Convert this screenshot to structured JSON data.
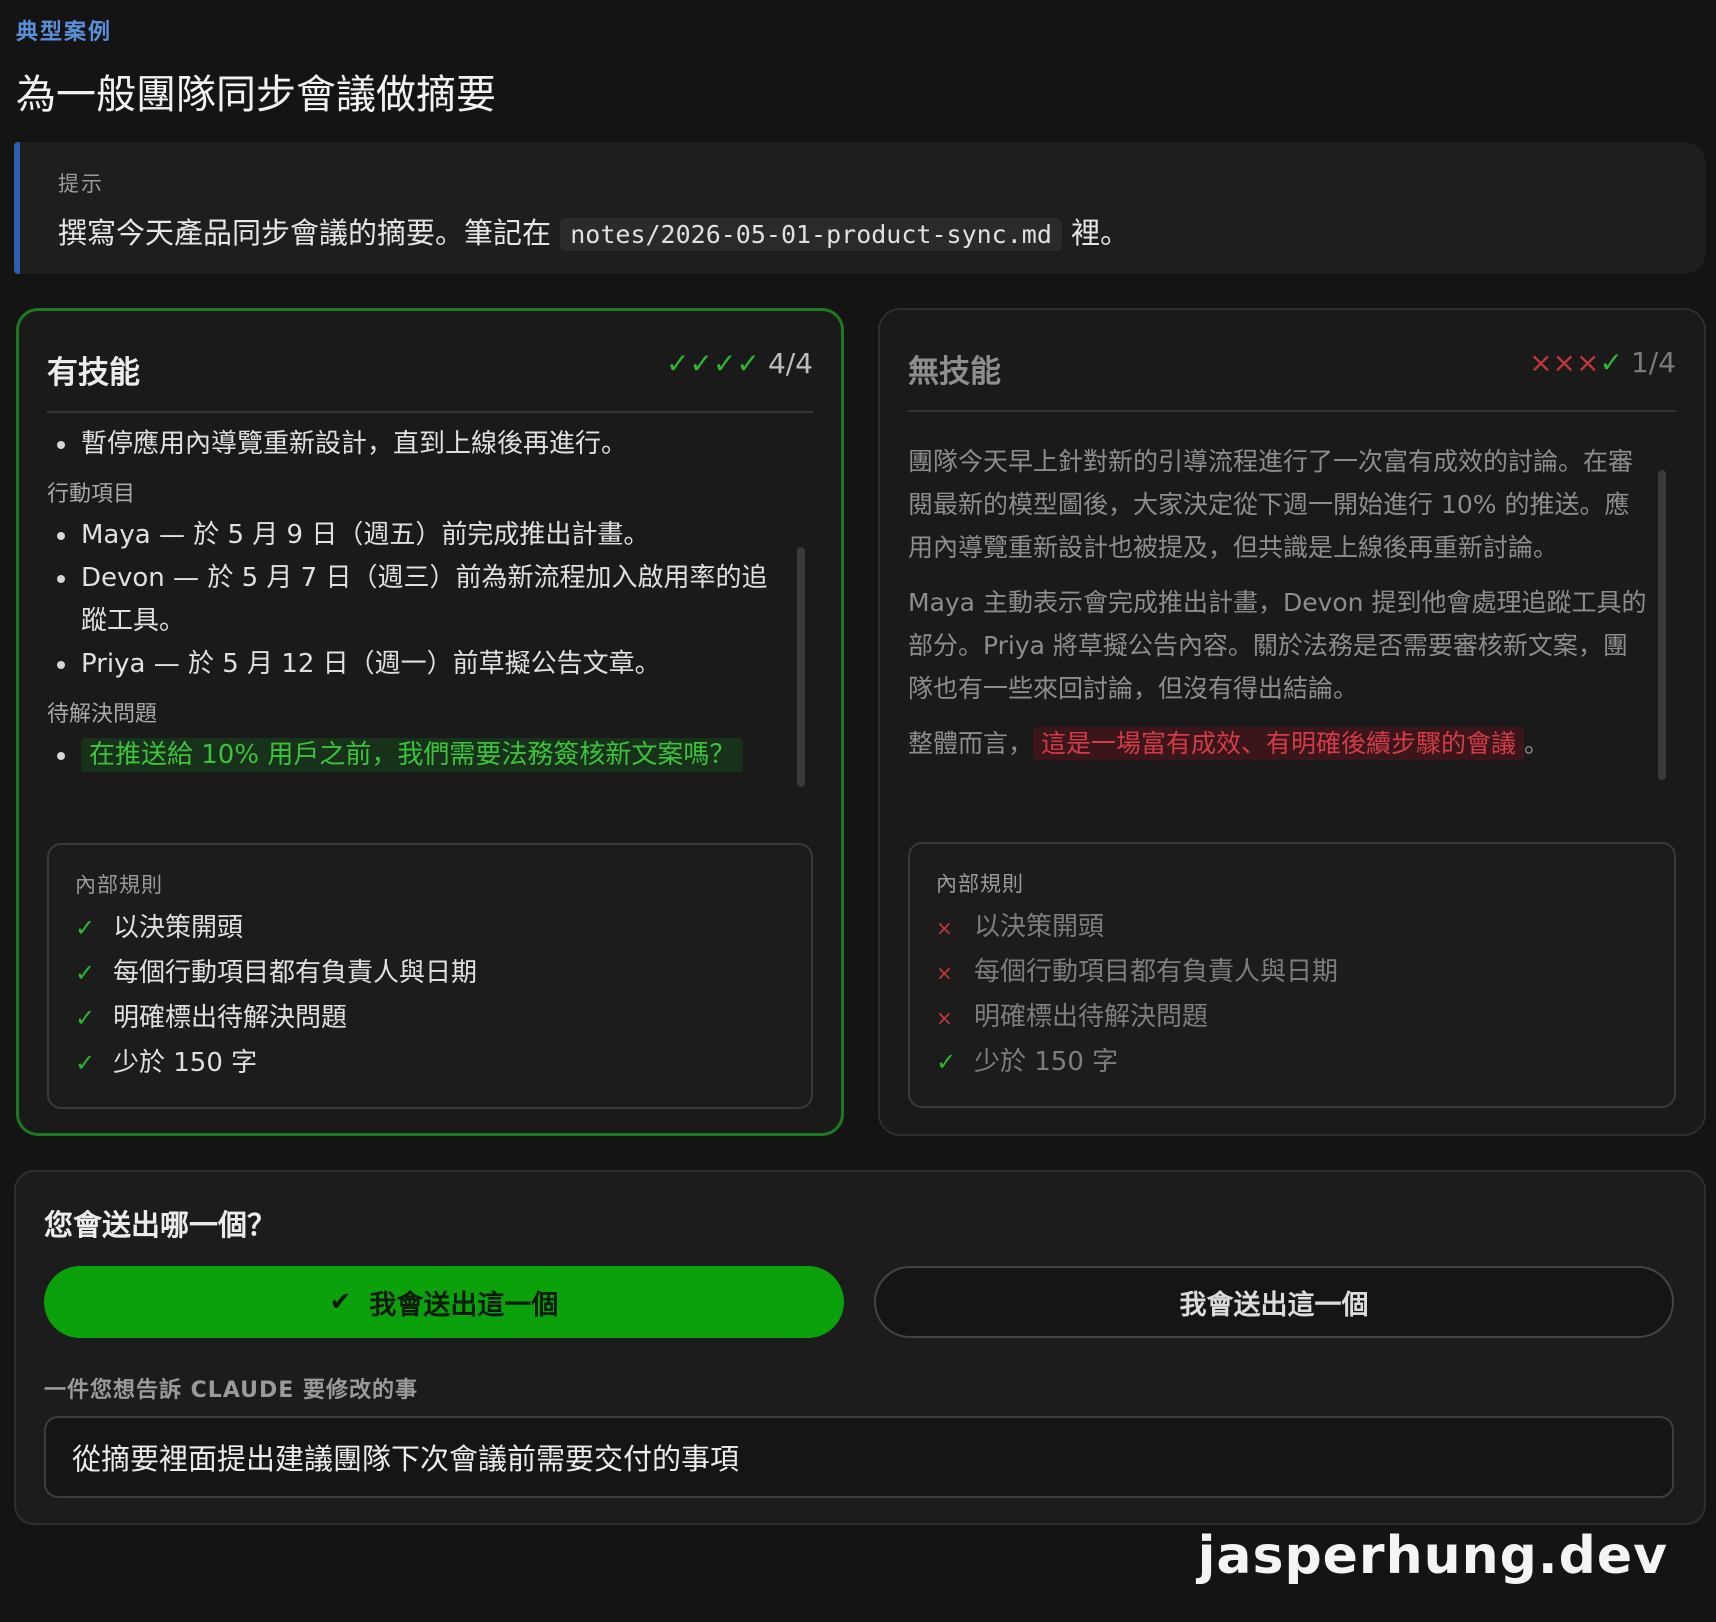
{
  "eyebrow": "典型案例",
  "title": "為一般團隊同步會議做摘要",
  "prompt": {
    "label": "提示",
    "text_before": "撰寫今天產品同步會議的摘要。筆記在 ",
    "code": "notes/2026-05-01-product-sync.md",
    "text_after": " 裡。"
  },
  "with_skill": {
    "title": "有技能",
    "score_marks": "✓✓✓✓",
    "score": "4/4",
    "top_bullet": "暫停應用內導覽重新設計，直到上線後再進行。",
    "action_label": "行動項目",
    "actions": [
      "Maya — 於 5 月 9 日（週五）前完成推出計畫。",
      "Devon — 於 5 月 7 日（週三）前為新流程加入啟用率的追蹤工具。",
      "Priya — 於 5 月 12 日（週一）前草擬公告文章。"
    ],
    "open_label": "待解決問題",
    "open_question": "在推送給 10% 用戶之前，我們需要法務簽核新文案嗎？",
    "rules_title": "內部規則",
    "rules": [
      {
        "mark": "✓",
        "text": "以決策開頭"
      },
      {
        "mark": "✓",
        "text": "每個行動項目都有負責人與日期"
      },
      {
        "mark": "✓",
        "text": "明確標出待解決問題"
      },
      {
        "mark": "✓",
        "text": "少於 150 字"
      }
    ]
  },
  "without_skill": {
    "title": "無技能",
    "score_marks_bad": "×××",
    "score_marks_ok": "✓",
    "score": "1/4",
    "para1": "團隊今天早上針對新的引導流程進行了一次富有成效的討論。在審閱最新的模型圖後，大家決定從下週一開始進行 10% 的推送。應用內導覽重新設計也被提及，但共識是上線後再重新討論。",
    "para2": "Maya 主動表示會完成推出計畫，Devon 提到他會處理追蹤工具的部分。Priya 將草擬公告內容。關於法務是否需要審核新文案，團隊也有一些來回討論，但沒有得出結論。",
    "para3_before": "整體而言，",
    "para3_highlight": "這是一場富有成效、有明確後續步驟的會議",
    "para3_after": "。",
    "rules_title": "內部規則",
    "rules": [
      {
        "mark": "×",
        "text": "以決策開頭"
      },
      {
        "mark": "×",
        "text": "每個行動項目都有負責人與日期"
      },
      {
        "mark": "×",
        "text": "明確標出待解決問題"
      },
      {
        "mark": "✓",
        "text": "少於 150 字"
      }
    ]
  },
  "question": {
    "title": "您會送出哪一個？",
    "left_button": "我會送出這一個",
    "left_check": "✔",
    "right_button": "我會送出這一個",
    "feedback_label": "一件您想告訴 CLAUDE 要修改的事",
    "feedback_value": "從摘要裡面提出建議團隊下次會議前需要交付的事項"
  },
  "watermark": "jasperhung.dev",
  "colors": {
    "accent_blue": "#2c5fb0",
    "success_green": "#0aa10a",
    "error_red": "#c23838"
  }
}
